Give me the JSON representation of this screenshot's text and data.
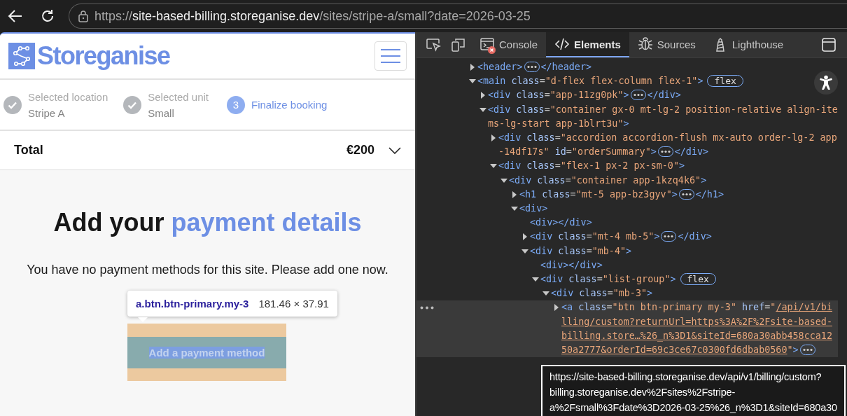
{
  "browser": {
    "url_scheme": "https://",
    "url_host": "site-based-billing.storeganise.dev",
    "url_path": "/sites/stripe-a/small?date=2026-03-25"
  },
  "page": {
    "brand": "Storeganise",
    "steps": [
      {
        "kind": "completed",
        "title": "Selected location",
        "value": "Stripe A"
      },
      {
        "kind": "completed",
        "title": "Selected unit",
        "value": "Small"
      },
      {
        "kind": "current",
        "number": "3",
        "title": "Finalize booking"
      }
    ],
    "total": {
      "label": "Total",
      "amount": "€200",
      "expanded": false
    },
    "heading_start": "Add your",
    "heading_highlight": "payment details",
    "message": "You have no payment methods for this site. Please add one now.",
    "button": "Add a payment method",
    "inspect_tooltip": {
      "selector": "a.btn.btn-primary.my-3",
      "size": "181.46 × 37.91"
    }
  },
  "devtools": {
    "tabs": [
      {
        "kind": "console",
        "label": "Console",
        "selected": false,
        "error": true
      },
      {
        "kind": "elements",
        "label": "Elements",
        "selected": true,
        "error": false
      },
      {
        "kind": "sources",
        "label": "Sources",
        "selected": false,
        "error": false
      },
      {
        "kind": "lighthouse",
        "label": "Lighthouse",
        "selected": false,
        "error": false
      }
    ],
    "dom_tree": [
      {
        "markup": "<header>",
        "collapsed_content": true,
        "closing": "</header>",
        "expanded": false,
        "selected": false
      },
      {
        "markup": "<main class=\"d-flex flex-column flex-1\">",
        "badge": "flex",
        "expanded": true,
        "selected": false,
        "children": [
          {
            "markup": "<div class=\"app-11zg0pk\">",
            "collapsed_content": true,
            "closing": "</div>",
            "expanded": false,
            "selected": false
          },
          {
            "markup": "<div class=\"container gx-0 mt-lg-2 position-relative align-items-lg-start app-1blrt3u\">",
            "expanded": true,
            "selected": false,
            "children": [
              {
                "markup": "<div class=\"accordion accordion-flush mx-auto order-lg-2 app-14df17s\" id=\"orderSummary\">",
                "collapsed_content": true,
                "closing": "</div>",
                "expanded": false,
                "selected": false
              },
              {
                "markup": "<div class=\"flex-1 px-2 px-sm-0\">",
                "expanded": true,
                "selected": false,
                "children": [
                  {
                    "markup": "<div class=\"container app-1kzq4k6\">",
                    "expanded": true,
                    "selected": false,
                    "children": [
                      {
                        "markup": "<h1 class=\"mt-5 app-bz3gyv\">",
                        "collapsed_content": true,
                        "closing": "</h1>",
                        "expanded": false,
                        "selected": false
                      },
                      {
                        "markup": "<div>",
                        "expanded": true,
                        "selected": false,
                        "children": [
                          {
                            "markup": "<div></div>",
                            "selected": false
                          },
                          {
                            "markup": "<div class=\"mt-4 mb-5\">",
                            "collapsed_content": true,
                            "closing": "</div>",
                            "expanded": false,
                            "selected": false
                          },
                          {
                            "markup": "<div class=\"mb-4\">",
                            "expanded": true,
                            "selected": false,
                            "children": [
                              {
                                "markup": "<div></div>",
                                "selected": false
                              },
                              {
                                "markup": "<div class=\"list-group\">",
                                "badge": "flex",
                                "expanded": true,
                                "selected": false,
                                "children": [
                                  {
                                    "markup": "<div class=\"mb-3\">",
                                    "expanded": true,
                                    "selected": false,
                                    "children": [
                                      {
                                        "markup": "<a class=\"btn btn-primary my-3\" href=\"/api/v1/billing/custom?returnUrl=https%3A%2F%2Fsite-based-billing.store…%26_n%3D1&siteId=680a30abb458cca1250a2777&orderId=69c3ce67c0300fd6dbab0560\">",
                                        "linked": true,
                                        "collapsed_content": true,
                                        "expanded": false,
                                        "selected": true
                                      }
                                    ]
                                  }
                                ]
                              }
                            ]
                          }
                        ]
                      }
                    ]
                  }
                ]
              }
            ]
          }
        ]
      }
    ],
    "link_tooltip": [
      "https://site-based-billing.storeganise.dev/api/v1/billing/custom?",
      "billing.storeganise.dev%2Fsites%2Fstripe-",
      "a%2Fsmall%3Fdate%3D2026-03-25%26_n%3D1&siteId=680a30"
    ]
  }
}
